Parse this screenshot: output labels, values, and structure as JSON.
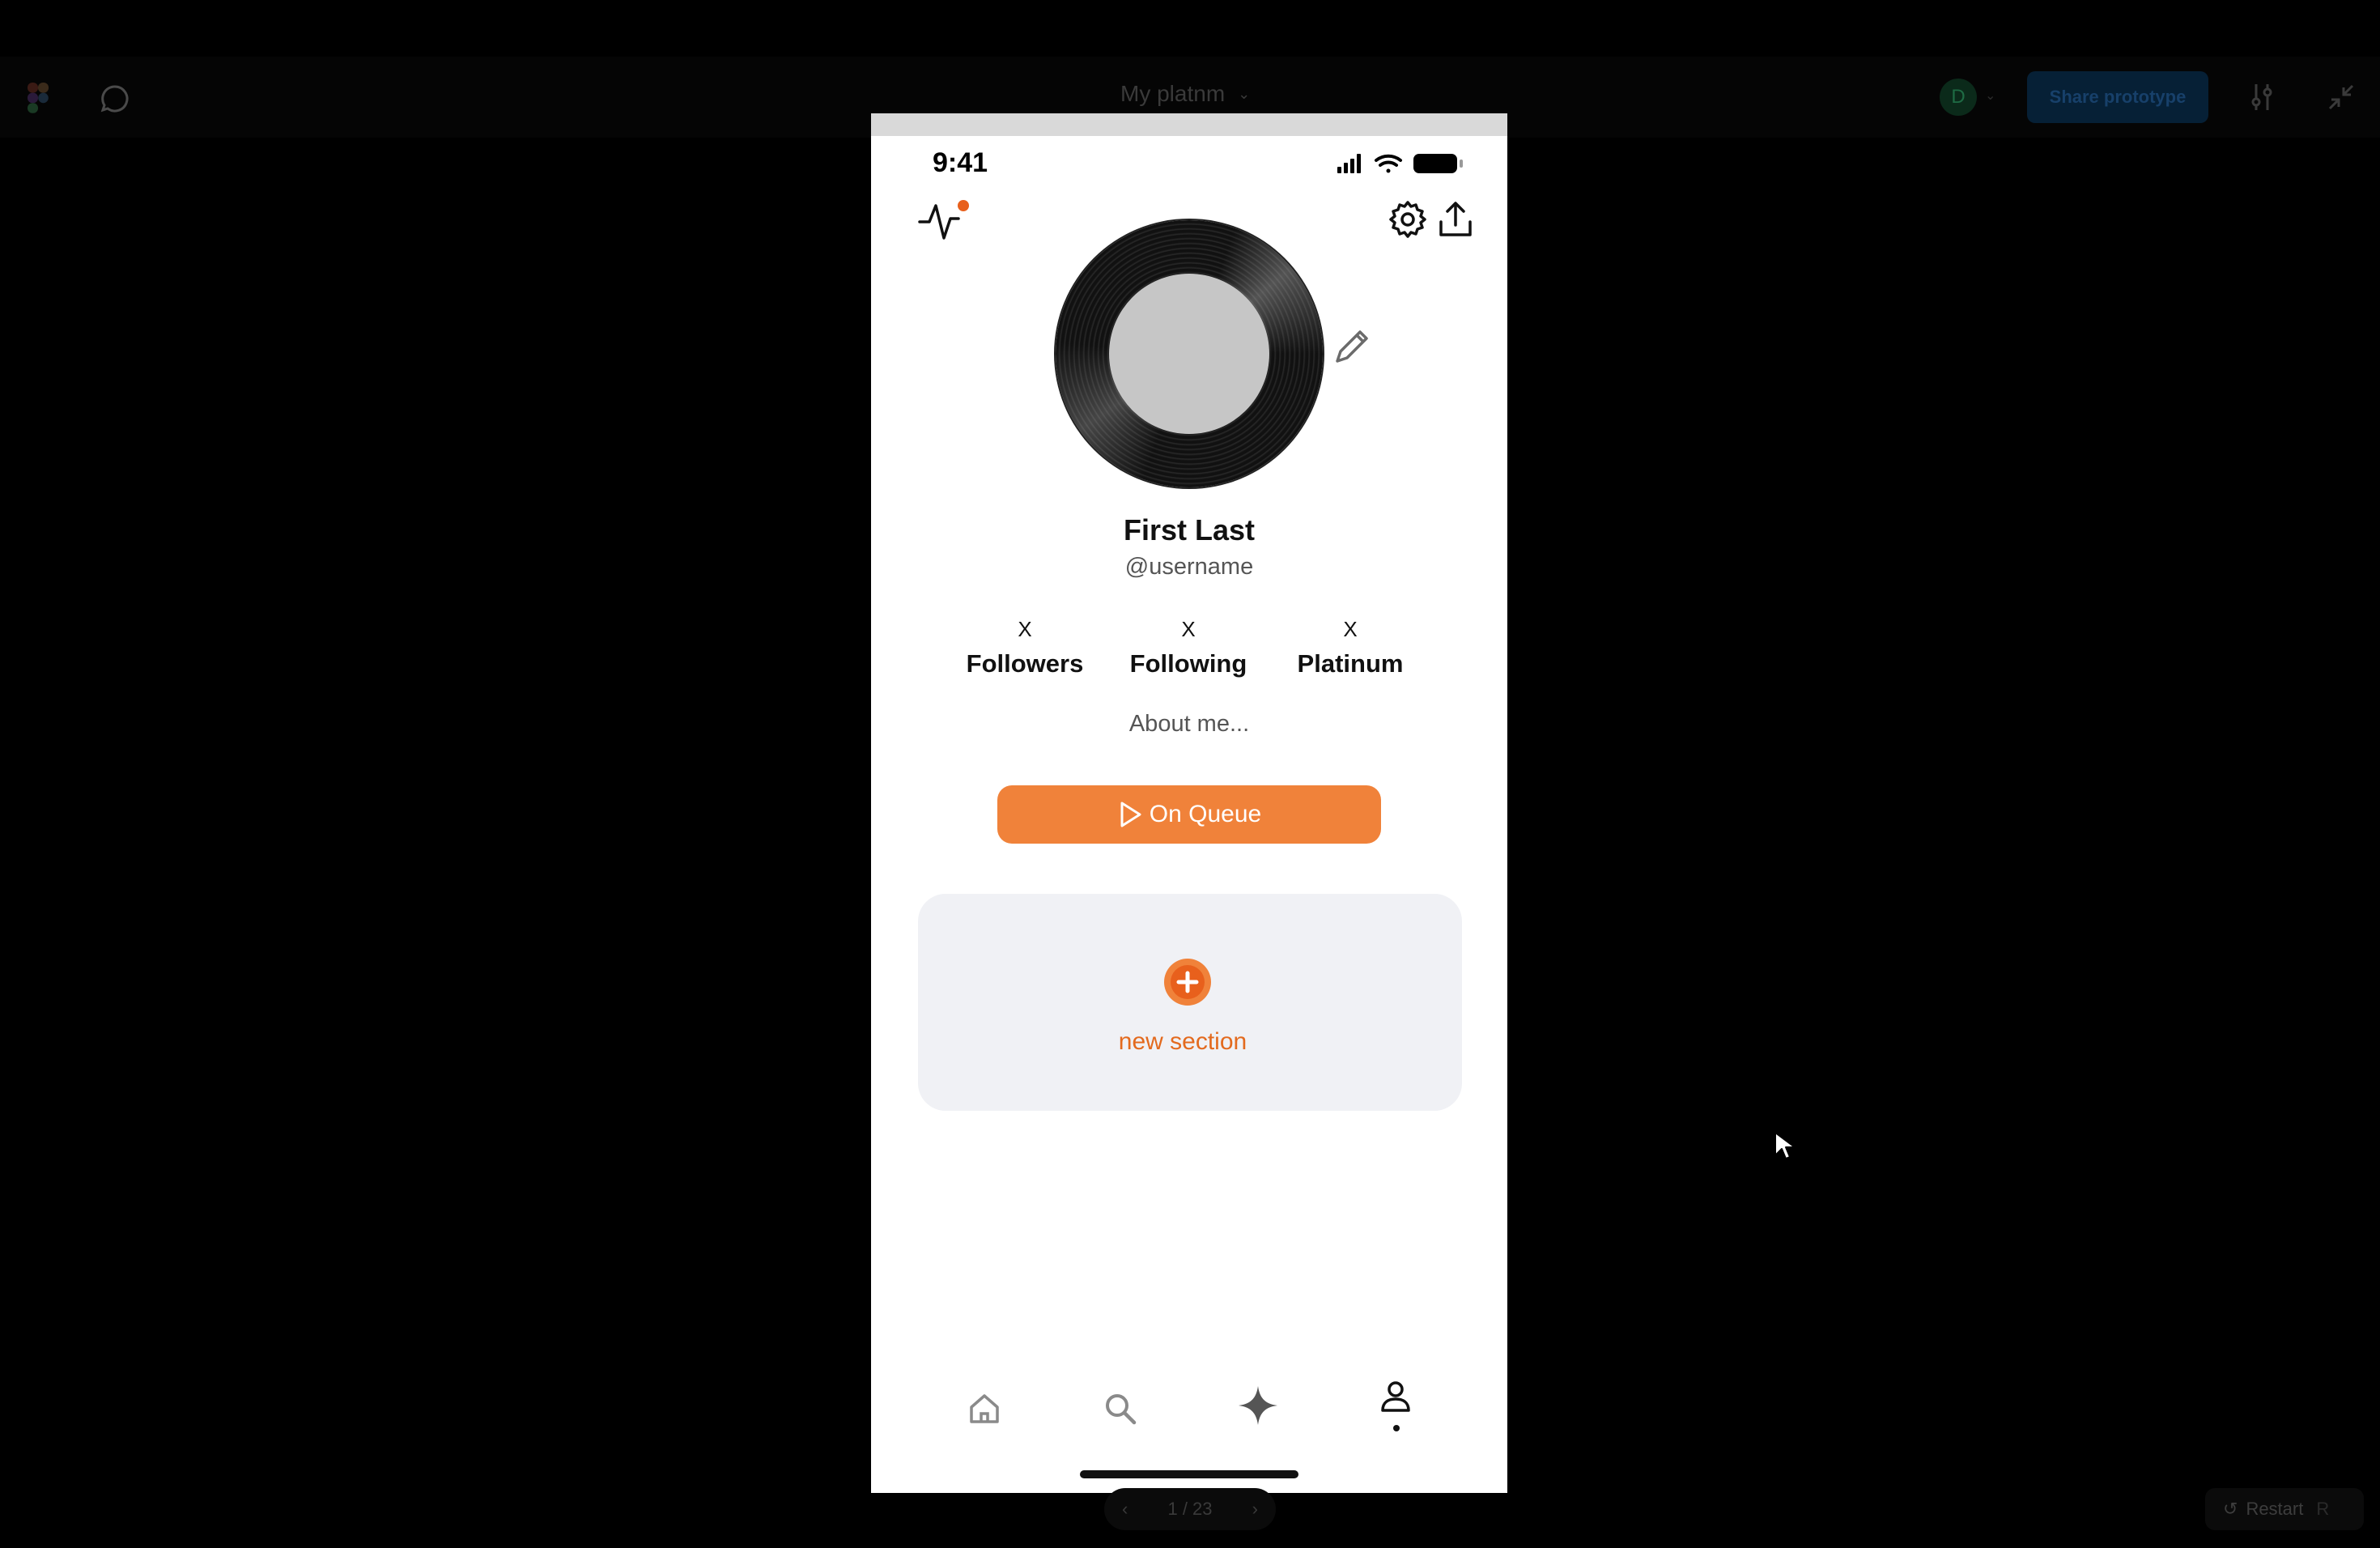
{
  "figma": {
    "doc_title": "My platnm",
    "user_initial": "D",
    "share_label": "Share prototype",
    "pager": {
      "text": "1 / 23",
      "prev": "‹",
      "next": "›"
    },
    "restart": {
      "label": "Restart",
      "shortcut": "R"
    }
  },
  "phone": {
    "status": {
      "time": "9:41"
    },
    "profile": {
      "name": "First Last",
      "username": "@username",
      "stats": [
        {
          "count": "X",
          "label": "Followers"
        },
        {
          "count": "X",
          "label": "Following"
        },
        {
          "count": "X",
          "label": "Platinum"
        }
      ],
      "about": "About me..."
    },
    "queue_button": "On Queue",
    "new_section_label": "new section",
    "tabs": [
      "home-icon",
      "search-icon",
      "sparkle-icon",
      "profile-icon"
    ]
  },
  "colors": {
    "accent": "#f0823a",
    "accent_text": "#e36a1e",
    "notification_dot": "#e8601c",
    "card_bg": "#f0f1f5"
  }
}
